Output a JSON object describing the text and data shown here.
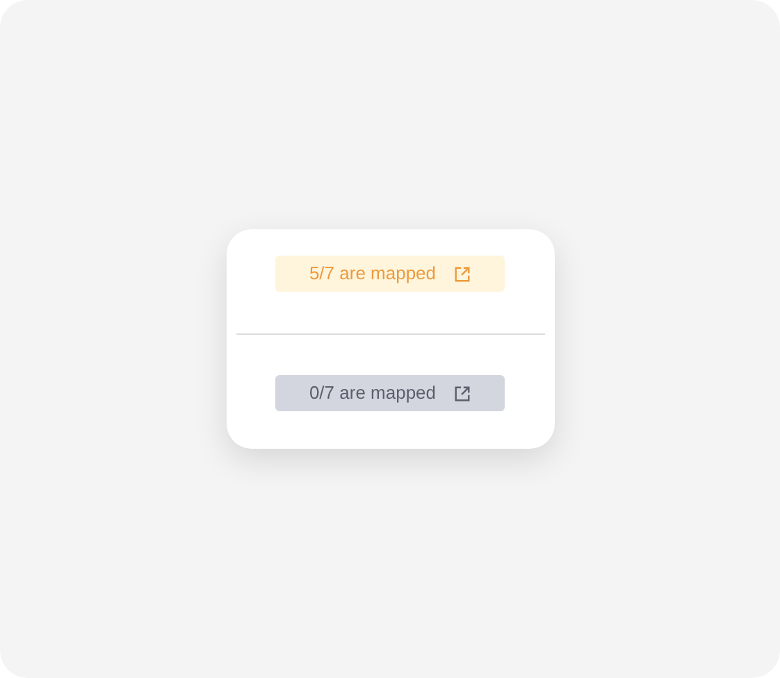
{
  "badges": [
    {
      "label": "5/7 are mapped",
      "kind": "partial"
    },
    {
      "label": "0/7 are mapped",
      "kind": "none"
    }
  ]
}
